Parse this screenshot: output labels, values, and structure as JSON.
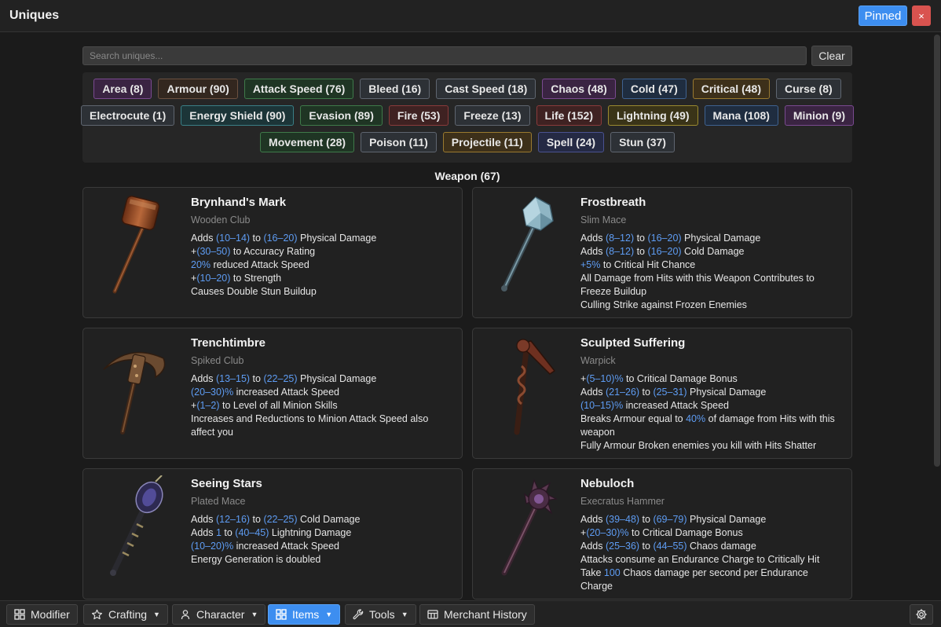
{
  "window": {
    "title": "Uniques",
    "pinned_label": "Pinned",
    "close_label": "×"
  },
  "search": {
    "placeholder": "Search uniques...",
    "value": "",
    "clear_label": "Clear"
  },
  "tag_rows": [
    [
      {
        "label": "Area (8)",
        "bg": "#3a2442",
        "border": "#7a4a90"
      },
      {
        "label": "Armour (90)",
        "bg": "#33271f",
        "border": "#6b5040"
      },
      {
        "label": "Attack Speed (76)",
        "bg": "#1f3524",
        "border": "#3f7a4a"
      },
      {
        "label": "Bleed (16)",
        "bg": "#2d3136",
        "border": "#5f6670"
      },
      {
        "label": "Cast Speed (18)",
        "bg": "#2d3136",
        "border": "#5f6670"
      },
      {
        "label": "Chaos (48)",
        "bg": "#3a2442",
        "border": "#7a4a90"
      },
      {
        "label": "Cold (47)",
        "bg": "#1f2d40",
        "border": "#3f6290"
      },
      {
        "label": "Critical (48)",
        "bg": "#3d301a",
        "border": "#9a7a30"
      },
      {
        "label": "Curse (8)",
        "bg": "#2d3136",
        "border": "#5f6670"
      }
    ],
    [
      {
        "label": "Electrocute (1)",
        "bg": "#2d3136",
        "border": "#5f6670"
      },
      {
        "label": "Energy Shield (90)",
        "bg": "#1c3538",
        "border": "#3a7f86"
      },
      {
        "label": "Evasion (89)",
        "bg": "#1f3524",
        "border": "#3f7a4a"
      },
      {
        "label": "Fire (53)",
        "bg": "#3f2222",
        "border": "#8a3a3a"
      },
      {
        "label": "Freeze (13)",
        "bg": "#2d3136",
        "border": "#5f6670"
      },
      {
        "label": "Life (152)",
        "bg": "#3f2222",
        "border": "#8a3a3a"
      },
      {
        "label": "Lightning (49)",
        "bg": "#3a3418",
        "border": "#9a8a30"
      },
      {
        "label": "Mana (108)",
        "bg": "#1f2d40",
        "border": "#3f6290"
      },
      {
        "label": "Minion (9)",
        "bg": "#3a2442",
        "border": "#7a4a90"
      }
    ],
    [
      {
        "label": "Movement (28)",
        "bg": "#1f3524",
        "border": "#3f7a4a"
      },
      {
        "label": "Poison (11)",
        "bg": "#2d3136",
        "border": "#5f6670"
      },
      {
        "label": "Projectile (11)",
        "bg": "#3d301a",
        "border": "#9a7a30"
      },
      {
        "label": "Spell (24)",
        "bg": "#252a44",
        "border": "#4a5290"
      },
      {
        "label": "Stun (37)",
        "bg": "#2d3136",
        "border": "#5f6670"
      }
    ]
  ],
  "section": {
    "title": "Weapon (67)"
  },
  "items": [
    {
      "name": "Brynhand's Mark",
      "base": "Wooden Club",
      "icon": "wooden-club-icon",
      "mods": [
        [
          "Adds ",
          {
            "v": "(10–14)"
          },
          " to ",
          {
            "v": "(16–20)"
          },
          " Physical Damage"
        ],
        [
          "+",
          {
            "v": "(30–50)"
          },
          " to Accuracy Rating"
        ],
        [
          {
            "v": "20%"
          },
          " reduced Attack Speed"
        ],
        [
          "+",
          {
            "v": "(10–20)"
          },
          " to Strength"
        ],
        [
          "Causes Double Stun Buildup"
        ]
      ]
    },
    {
      "name": "Frostbreath",
      "base": "Slim Mace",
      "icon": "slim-mace-icon",
      "mods": [
        [
          "Adds ",
          {
            "v": "(8–12)"
          },
          " to ",
          {
            "v": "(16–20)"
          },
          " Physical Damage"
        ],
        [
          "Adds ",
          {
            "v": "(8–12)"
          },
          " to ",
          {
            "v": "(16–20)"
          },
          " Cold Damage"
        ],
        [
          {
            "v": "+5%"
          },
          " to Critical Hit Chance"
        ],
        [
          "All Damage from Hits with this Weapon Contributes to Freeze Buildup"
        ],
        [
          "Culling Strike against Frozen Enemies"
        ]
      ]
    },
    {
      "name": "Trenchtimbre",
      "base": "Spiked Club",
      "icon": "spiked-club-icon",
      "mods": [
        [
          "Adds ",
          {
            "v": "(13–15)"
          },
          " to ",
          {
            "v": "(22–25)"
          },
          " Physical Damage"
        ],
        [
          {
            "v": "(20–30)%"
          },
          " increased Attack Speed"
        ],
        [
          "+",
          {
            "v": "(1–2)"
          },
          " to Level of all Minion Skills"
        ],
        [
          "Increases and Reductions to Minion Attack Speed also affect you"
        ]
      ]
    },
    {
      "name": "Sculpted Suffering",
      "base": "Warpick",
      "icon": "warpick-icon",
      "mods": [
        [
          "+",
          {
            "v": "(5–10)%"
          },
          " to Critical Damage Bonus"
        ],
        [
          "Adds ",
          {
            "v": "(21–26)"
          },
          " to ",
          {
            "v": "(25–31)"
          },
          " Physical Damage"
        ],
        [
          {
            "v": "(10–15)%"
          },
          " increased Attack Speed"
        ],
        [
          "Breaks Armour equal to ",
          {
            "v": "40%"
          },
          " of damage from Hits with this weapon"
        ],
        [
          "Fully Armour Broken enemies you kill with Hits Shatter"
        ]
      ]
    },
    {
      "name": "Seeing Stars",
      "base": "Plated Mace",
      "icon": "plated-mace-icon",
      "mods": [
        [
          "Adds ",
          {
            "v": "(12–16)"
          },
          " to ",
          {
            "v": "(22–25)"
          },
          " Cold Damage"
        ],
        [
          "Adds ",
          {
            "v": "1"
          },
          " to ",
          {
            "v": "(40–45)"
          },
          " Lightning Damage"
        ],
        [
          {
            "v": "(10–20)%"
          },
          " increased Attack Speed"
        ],
        [
          "Energy Generation is doubled"
        ]
      ]
    },
    {
      "name": "Nebuloch",
      "base": "Execratus Hammer",
      "icon": "execratus-hammer-icon",
      "mods": [
        [
          "Adds ",
          {
            "v": "(39–48)"
          },
          " to ",
          {
            "v": "(69–79)"
          },
          " Physical Damage"
        ],
        [
          "+",
          {
            "v": "(20–30)%"
          },
          " to Critical Damage Bonus"
        ],
        [
          "Adds ",
          {
            "v": "(25–36)"
          },
          " to ",
          {
            "v": "(44–55)"
          },
          " Chaos damage"
        ],
        [
          "Attacks consume an Endurance Charge to Critically Hit"
        ],
        [
          "Take ",
          {
            "v": "100"
          },
          " Chaos damage per second per Endurance Charge"
        ]
      ]
    }
  ],
  "bottom_nav": {
    "modifier": "Modifier",
    "crafting": "Crafting",
    "character": "Character",
    "items": "Items",
    "tools": "Tools",
    "merchant_history": "Merchant History",
    "active": "Items"
  }
}
